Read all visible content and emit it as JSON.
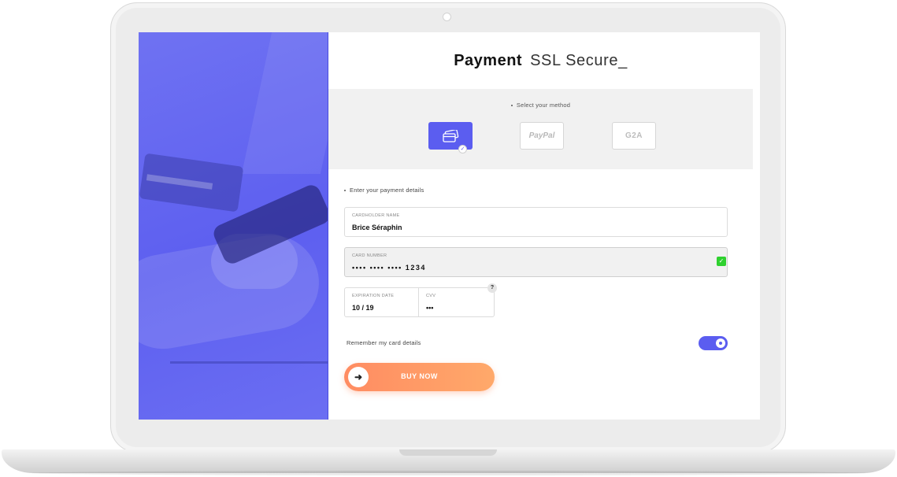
{
  "header": {
    "title_strong": "Payment",
    "title_light": "SSL Secure_"
  },
  "methods": {
    "label": "Select your method",
    "options": [
      {
        "name": "card",
        "icon": "credit-card-icon",
        "selected": true
      },
      {
        "name": "PayPal",
        "label": "PayPal",
        "selected": false
      },
      {
        "name": "G2A",
        "label": "G2A",
        "selected": false
      }
    ]
  },
  "details": {
    "label": "Enter your payment details",
    "cardholder": {
      "label": "CARDHOLDER NAME",
      "value": "Brice Séraphin"
    },
    "card_number": {
      "label": "CARD NUMBER",
      "value": "•••• •••• •••• 1234",
      "valid": true
    },
    "expiration": {
      "label": "EXPIRATION DATE",
      "value": "10 / 19"
    },
    "cvv": {
      "label": "CVV",
      "value": "•••",
      "help": "?"
    }
  },
  "remember": {
    "label": "Remember my card details",
    "enabled": true
  },
  "buy": {
    "label": "BUY NOW",
    "icon": "arrow-right-icon"
  },
  "colors": {
    "accent": "#5b5df0",
    "button_start": "#ff8c62",
    "button_end": "#ffa96a",
    "valid": "#2fd12f"
  }
}
